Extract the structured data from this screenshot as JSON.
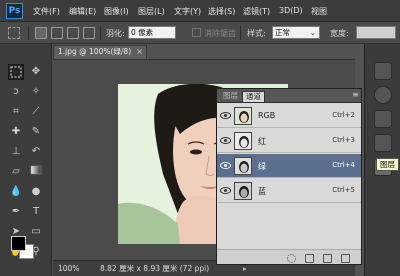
{
  "app": {
    "logo": "Ps"
  },
  "menu": [
    "文件(F)",
    "编辑(E)",
    "图像(I)",
    "图层(L)",
    "文字(Y)",
    "选择(S)",
    "滤镜(T)",
    "3D(D)",
    "视图"
  ],
  "options": {
    "feather_label": "羽化:",
    "feather_value": "0 像素",
    "antialias_label": "消除锯齿",
    "style_label": "样式:",
    "style_value": "正常",
    "width_label": "宽度:"
  },
  "document": {
    "tab_title": "1.jpg @ 100%(绿/8)",
    "close_glyph": "×",
    "zoom": "100%",
    "size_info": "8.82 厘米 x 8.93 厘米 (72 ppi)"
  },
  "channels_panel": {
    "tabs": [
      "图层",
      "通道"
    ],
    "active_tab": "通道",
    "channels": [
      {
        "name": "RGB",
        "shortcut": "Ctrl+2",
        "selected": false,
        "thumb": "color"
      },
      {
        "name": "红",
        "shortcut": "Ctrl+3",
        "selected": false,
        "thumb": "gray-light"
      },
      {
        "name": "绿",
        "shortcut": "Ctrl+4",
        "selected": true,
        "thumb": "gray-mid"
      },
      {
        "name": "蓝",
        "shortcut": "Ctrl+5",
        "selected": false,
        "thumb": "gray-dark"
      }
    ],
    "selection_color": "#5c6f90"
  },
  "tooltip": "图层",
  "tool_icons": [
    "rectangular-marquee-icon",
    "move-icon",
    "lasso-icon",
    "magic-wand-icon",
    "crop-icon",
    "eyedropper-icon",
    "healing-brush-icon",
    "brush-icon",
    "clone-stamp-icon",
    "history-brush-icon",
    "eraser-icon",
    "gradient-icon",
    "blur-icon",
    "dodge-icon",
    "pen-icon",
    "type-icon",
    "path-selection-icon",
    "shape-icon",
    "hand-icon",
    "zoom-icon"
  ]
}
